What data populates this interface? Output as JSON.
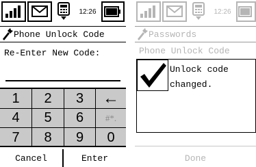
{
  "status": {
    "time": "12:26"
  },
  "left_screen": {
    "title": "Phone Unlock Code",
    "prompt": "Re-Enter New Code:",
    "entered_code": "",
    "keypad": {
      "rows": [
        [
          "1",
          "2",
          "3",
          "←"
        ],
        [
          "4",
          "5",
          "6",
          "#*."
        ],
        [
          "7",
          "8",
          "9",
          "0"
        ]
      ]
    },
    "softkeys": {
      "left": "Cancel",
      "right": "Enter"
    }
  },
  "right_screen": {
    "title": "Passwords",
    "section": "Phone Unlock Code",
    "message": "Unlock code changed.",
    "softkey": "Done"
  },
  "colors": {
    "keypad_bg": "#c9c9c9",
    "disabled_text": "#b5b5b5"
  }
}
